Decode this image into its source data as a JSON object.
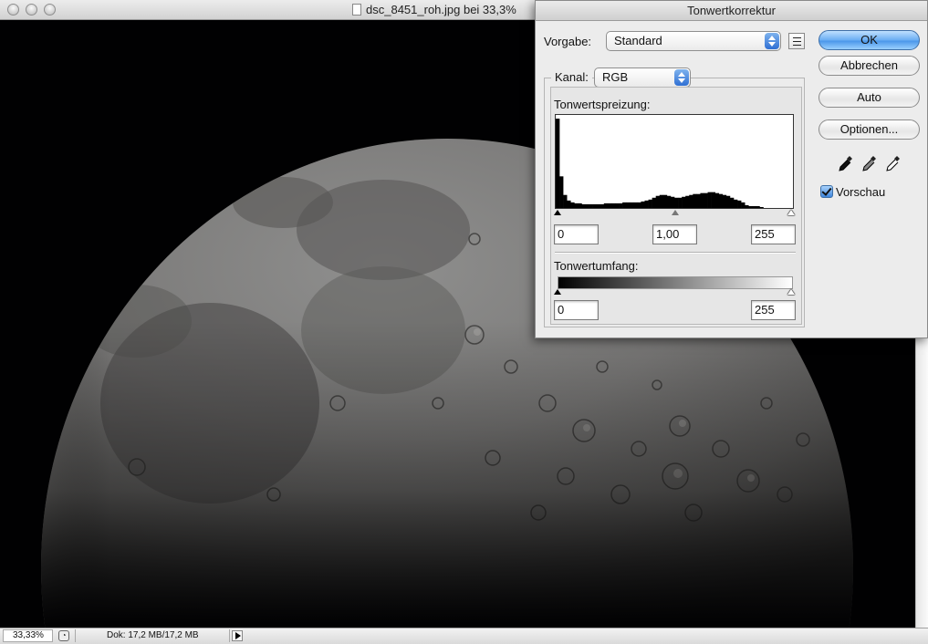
{
  "document": {
    "title": "dsc_8451_roh.jpg bei 33,3%",
    "zoom": "33,33%",
    "doc_info": "Dok: 17,2 MB/17,2 MB"
  },
  "dialog": {
    "title": "Tonwertkorrektur",
    "preset_label": "Vorgabe:",
    "preset_value": "Standard",
    "channel_label": "Kanal:",
    "channel_value": "RGB",
    "input_levels_label": "Tonwertspreizung:",
    "input_black": "0",
    "input_gamma": "1,00",
    "input_white": "255",
    "output_levels_label": "Tonwertumfang:",
    "output_black": "0",
    "output_white": "255",
    "buttons": {
      "ok": "OK",
      "cancel": "Abbrechen",
      "auto": "Auto",
      "options": "Optionen..."
    },
    "preview_label": "Vorschau",
    "preview_checked": true,
    "histogram": [
      96,
      34,
      14,
      8,
      6,
      5,
      5,
      4,
      4,
      4,
      4,
      4,
      4,
      5,
      5,
      5,
      5,
      5,
      6,
      6,
      6,
      6,
      6,
      7,
      8,
      9,
      11,
      13,
      14,
      14,
      13,
      12,
      11,
      11,
      12,
      13,
      14,
      15,
      15,
      16,
      16,
      17,
      17,
      16,
      15,
      14,
      13,
      11,
      9,
      8,
      6,
      3,
      2,
      2,
      2,
      1,
      0,
      0,
      0,
      0,
      0,
      0,
      0,
      0
    ]
  },
  "icons": {
    "preset_menu": "list-menu-icon",
    "black_eyedropper": "black-eyedropper-icon",
    "gray_eyedropper": "gray-eyedropper-icon",
    "white_eyedropper": "white-eyedropper-icon"
  }
}
